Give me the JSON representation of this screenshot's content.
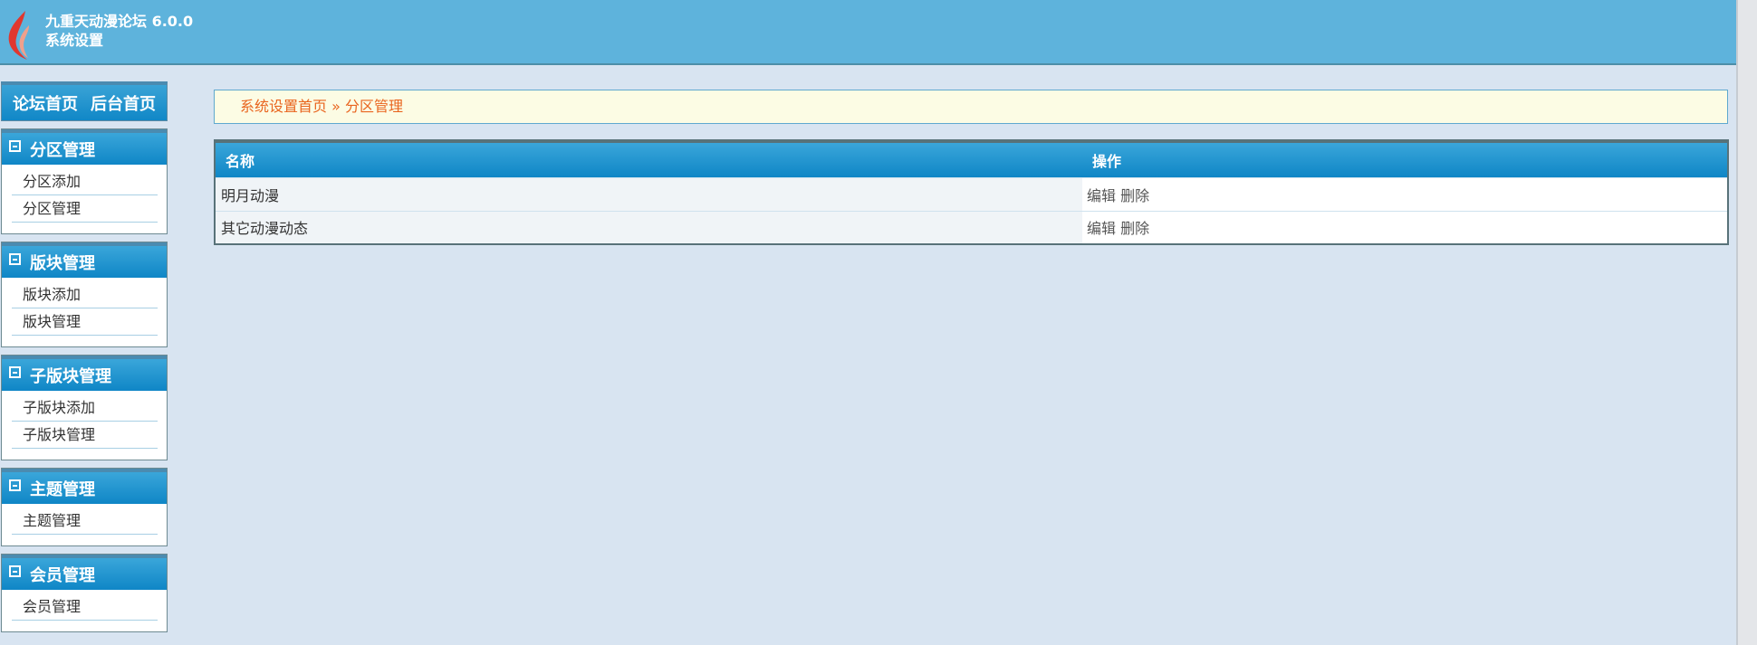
{
  "header": {
    "title": "九重天动漫论坛 6.0.0",
    "subtitle": "系统设置"
  },
  "nav": {
    "forum_home": "论坛首页",
    "admin_home": "后台首页"
  },
  "sidebar": {
    "sections": [
      {
        "title": "分区管理",
        "items": [
          "分区添加",
          "分区管理"
        ]
      },
      {
        "title": "版块管理",
        "items": [
          "版块添加",
          "版块管理"
        ]
      },
      {
        "title": "子版块管理",
        "items": [
          "子版块添加",
          "子版块管理"
        ]
      },
      {
        "title": "主题管理",
        "items": [
          "主题管理"
        ]
      },
      {
        "title": "会员管理",
        "items": [
          "会员管理"
        ]
      }
    ]
  },
  "breadcrumb": {
    "root": "系统设置首页",
    "separator": "»",
    "current": "分区管理"
  },
  "table": {
    "headers": [
      "名称",
      "操作"
    ],
    "rows": [
      {
        "name": "明月动漫",
        "edit": "编辑",
        "delete": "删除"
      },
      {
        "name": "其它动漫动态",
        "edit": "编辑",
        "delete": "删除"
      }
    ]
  },
  "colors": {
    "header_bg": "#5eb3dc",
    "page_bg": "#d8e4f1",
    "accent_blue": "#0f86c6",
    "breadcrumb_text": "#e9651f",
    "breadcrumb_bg": "#fcfce4"
  },
  "icons": {
    "logo": "flame-logo-icon",
    "collapse": "collapse-minus-icon"
  }
}
